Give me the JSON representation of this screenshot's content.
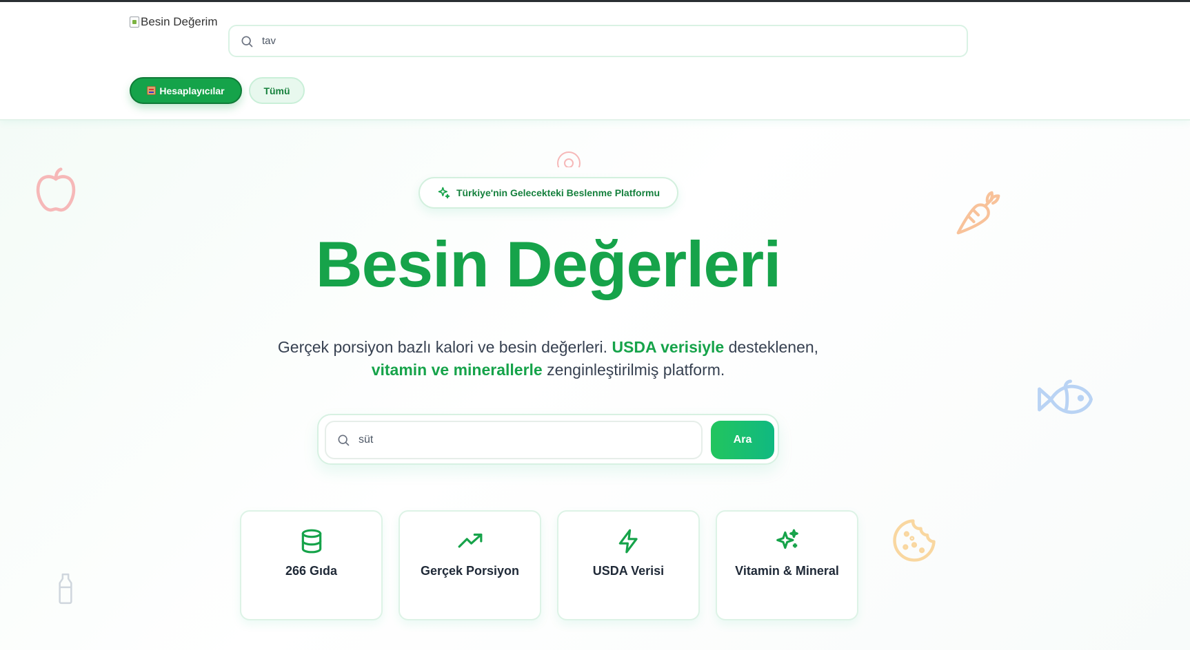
{
  "header": {
    "logo_alt": "Besin Değerim",
    "search": {
      "value": "tav",
      "placeholder": ""
    },
    "nav": [
      {
        "label": "Hesaplayıcılar",
        "icon": "abacus-icon",
        "active": true
      },
      {
        "label": "Tümü",
        "active": false
      }
    ]
  },
  "hero": {
    "badge": "Türkiye'nin Gelecekteki Beslenme Platformu",
    "title": "Besin Değerleri",
    "subtitle": {
      "part1": "Gerçek porsiyon bazlı kalori ve besin değerleri. ",
      "highlight1": "USDA verisiyle",
      "part2": " desteklenen, ",
      "highlight2": "vitamin ve minerallerle",
      "part3": " zenginleştirilmiş platform."
    },
    "search": {
      "value": "süt",
      "button": "Ara"
    },
    "features": [
      {
        "label": "266 Gıda",
        "icon": "database-icon"
      },
      {
        "label": "Gerçek Porsiyon",
        "icon": "trending-up-icon"
      },
      {
        "label": "USDA Verisi",
        "icon": "lightning-icon"
      },
      {
        "label": "Vitamin & Mineral",
        "icon": "sparkles-icon"
      }
    ]
  },
  "decorations": [
    "apple-icon",
    "carrot-icon",
    "fish-icon",
    "cookie-icon",
    "milk-bottle-icon",
    "donut-icon"
  ],
  "colors": {
    "brand_green": "#16a34a",
    "accent_teal": "#10b981",
    "text_dark": "#1f2937"
  }
}
